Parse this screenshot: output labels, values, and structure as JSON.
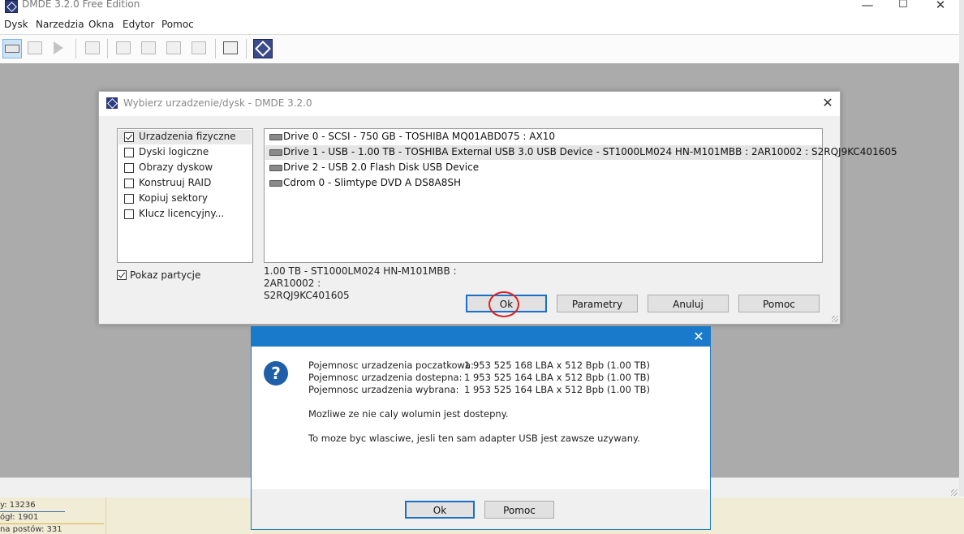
{
  "window": {
    "title": "DMDE 3.2.0 Free Edition",
    "controls": {
      "minimize": "—",
      "maximize": "☐",
      "close": "✕"
    }
  },
  "menu": [
    "Dysk",
    "Narzedzia",
    "Okna",
    "Edytor",
    "Pomoc"
  ],
  "toolbar_icons": [
    "open-disk-icon",
    "partitions-icon",
    "play-icon",
    "new-file-icon",
    "list-icon",
    "list-icon",
    "list-icon",
    "search-list-icon",
    "copy-icon",
    "dmde-logo-icon"
  ],
  "device_dialog": {
    "title": "Wybierz urzadzenie/dysk - DMDE 3.2.0",
    "close": "✕",
    "categories": [
      {
        "label": "Urzadzenia fizyczne",
        "checked": true,
        "selected": true
      },
      {
        "label": "Dyski logiczne",
        "checked": false
      },
      {
        "label": "Obrazy dyskow",
        "checked": false
      },
      {
        "label": "Konstruuj RAID",
        "checked": false
      },
      {
        "label": "Kopiuj sektory",
        "checked": false
      },
      {
        "label": "Klucz licencyjny...",
        "checked": false
      }
    ],
    "show_partitions": {
      "label": "Pokaz partycje",
      "checked": true
    },
    "devices": [
      {
        "label": "Drive 0 - SCSI - 750 GB - TOSHIBA MQ01ABD075 : AX10"
      },
      {
        "label": "Drive 1 - USB - 1.00 TB - TOSHIBA External USB 3.0 USB Device - ST1000LM024 HN-M101MBB : 2AR10002 : S2RQJ9KC401605",
        "selected": true
      },
      {
        "label": "Drive 2 - USB 2.0 Flash Disk USB Device"
      },
      {
        "label": "Cdrom 0 - Slimtype DVD A DS8A8SH"
      }
    ],
    "info_line1": "1.00 TB - ST1000LM024 HN-M101MBB : 2AR10002 :",
    "info_line2": "S2RQJ9KC401605",
    "buttons": {
      "ok": "Ok",
      "params": "Parametry",
      "cancel": "Anuluj",
      "help": "Pomoc"
    }
  },
  "message_dialog": {
    "close": "✕",
    "icon": "question-icon",
    "rows": [
      {
        "label": "Pojemnosc urzadzenia poczatkowa:",
        "value": "1 953 525 168 LBA x 512 Bpb (1.00 TB)"
      },
      {
        "label": "Pojemnosc urzadzenia dostepna:",
        "value": "1 953 525 164 LBA x 512 Bpb (1.00 TB)"
      },
      {
        "label": "Pojemnosc urzadzenia wybrana:",
        "value": "1 953 525 164 LBA x 512 Bpb (1.00 TB)"
      }
    ],
    "text1": "Mozliwe ze nie caly wolumin jest dostepny.",
    "text2": "To moze byc wlasciwe, jesli ten sam adapter USB jest zawsze uzywany.",
    "buttons": {
      "ok": "Ok",
      "help": "Pomoc"
    }
  },
  "background_page": {
    "line1": "y:  13236",
    "line2": "ógł:  1901",
    "line3": "na postów:  331"
  },
  "colors": {
    "accent": "#1979ca",
    "annotation": "#e02020",
    "workspace": "#ababab"
  }
}
